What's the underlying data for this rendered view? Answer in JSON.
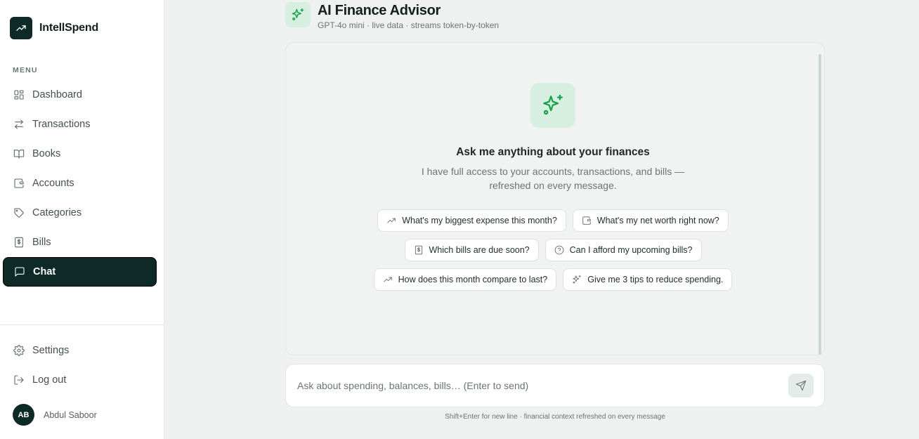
{
  "brand": {
    "name": "IntellSpend",
    "icon": "trending-up-icon"
  },
  "sidebar": {
    "menu_label": "MENU",
    "items": [
      {
        "label": "Dashboard",
        "icon": "layout-grid-icon"
      },
      {
        "label": "Transactions",
        "icon": "arrows-swap-icon"
      },
      {
        "label": "Books",
        "icon": "open-book-icon"
      },
      {
        "label": "Accounts",
        "icon": "wallet-icon"
      },
      {
        "label": "Categories",
        "icon": "tag-icon"
      },
      {
        "label": "Bills",
        "icon": "receipt-dollar-icon"
      },
      {
        "label": "Chat",
        "icon": "message-square-icon",
        "active": true
      }
    ],
    "bottom_items": [
      {
        "label": "Settings",
        "icon": "gear-icon"
      },
      {
        "label": "Log out",
        "icon": "logout-icon"
      }
    ],
    "user": {
      "initials": "AB",
      "name": "Abdul Saboor"
    }
  },
  "header": {
    "title": "AI Finance Advisor",
    "subtitle": "GPT-4o mini · live data · streams token-by-token",
    "icon": "sparkles-icon"
  },
  "empty_state": {
    "title": "Ask me anything about your finances",
    "subtitle": "I have full access to your accounts, transactions, and bills — refreshed on every message.",
    "icon": "sparkles-icon"
  },
  "suggestions": [
    [
      {
        "label": "What's my biggest expense this month?",
        "icon": "trending-up-icon"
      },
      {
        "label": "What's my net worth right now?",
        "icon": "wallet-icon"
      }
    ],
    [
      {
        "label": "Which bills are due soon?",
        "icon": "receipt-dollar-icon"
      },
      {
        "label": "Can I afford my upcoming bills?",
        "icon": "help-circle-icon"
      }
    ],
    [
      {
        "label": "How does this month compare to last?",
        "icon": "trending-up-icon"
      },
      {
        "label": "Give me 3 tips to reduce spending.",
        "icon": "sparkles-icon"
      }
    ]
  ],
  "composer": {
    "placeholder": "Ask about spending, balances, bills… (Enter to send)",
    "value": "",
    "send_icon": "send-icon",
    "hint": "Shift+Enter for new line · financial context refreshed on every message"
  },
  "colors": {
    "brand_dark": "#0d2a27",
    "accent_green": "#16a34a",
    "accent_tint": "#d7efe1",
    "background": "#eef1ef"
  }
}
